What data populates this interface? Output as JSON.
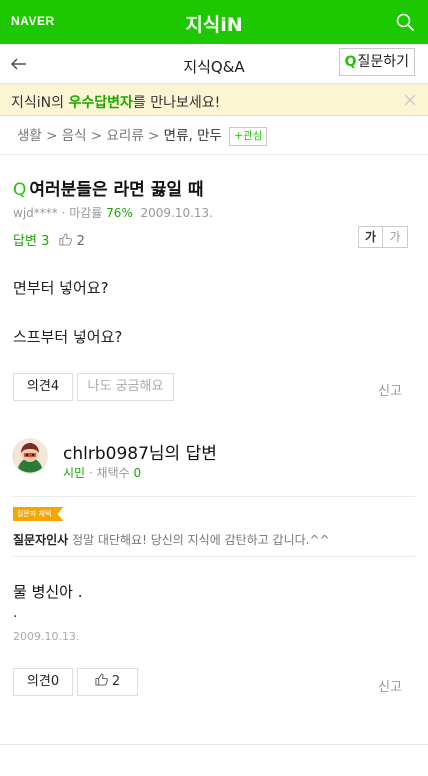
{
  "header": {
    "logo": "NAVER",
    "title": "지식iN",
    "search_icon": "search-icon",
    "brand_color": "#1ec800"
  },
  "subheader": {
    "back_icon": "back-arrow-icon",
    "title": "지식Q&A",
    "ask_q": "Q",
    "ask_label": "질문하기"
  },
  "banner": {
    "text_before": "지식iN의 ",
    "highlight": "우수답변자",
    "text_after": "를 만나보세요!",
    "close_icon": "close-icon"
  },
  "breadcrumb": {
    "items": [
      "생활",
      "음식",
      "요리류",
      "면류, 만두"
    ],
    "separator": " > ",
    "follow_label": "+관심"
  },
  "question": {
    "q_mark": "Q",
    "title": "여러분들은 라면 끓일 때",
    "author": "wjd****",
    "close_rate_label": "마감률",
    "close_rate": "76%",
    "date": "2009.10.13.",
    "answer_label": "답변",
    "answer_count": "3",
    "like_count": "2",
    "font_large": "가",
    "font_small": "가",
    "body_line1": "면부터 넣어요?",
    "body_line2": "스프부터 넣어요?",
    "opinion_button": "의견",
    "opinion_count": "4",
    "curious_button": "나도 궁금해요",
    "report": "신고"
  },
  "answer": {
    "user": "chlrb0987님의 답변",
    "rank": "시민",
    "adopt_label": "채택수",
    "adopt_count": "0",
    "badge": "질문자 채택",
    "thanks_label": "질문자인사",
    "thanks_text": "정말 대단해요! 당신의 지식에 감탄하고 갑니다.^^",
    "body": "물 병신아 .",
    "body_dot": ".",
    "date": "2009.10.13.",
    "opinion_button": "의견",
    "opinion_count": "0",
    "like_count": "2",
    "report": "신고"
  }
}
